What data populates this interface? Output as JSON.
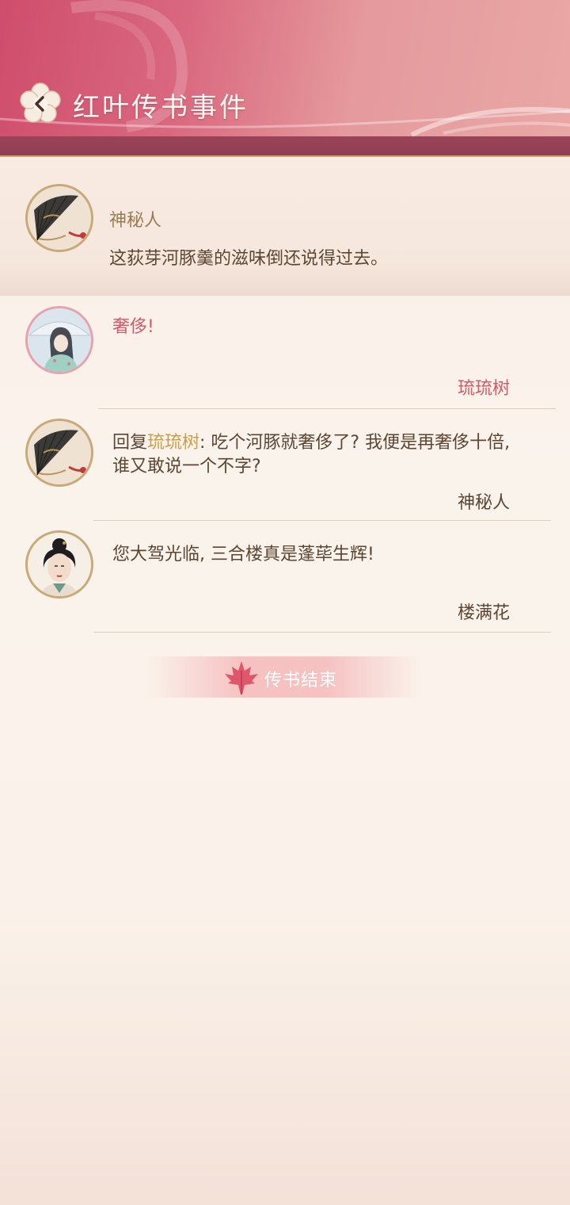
{
  "header": {
    "title": "红叶传书事件"
  },
  "post": {
    "author": "神秘人",
    "content": "这荻芽河豚羹的滋味倒还说得过去。",
    "avatar_icon": "folding-fan-icon"
  },
  "comments": [
    {
      "text": "奢侈!",
      "author": "琉琉树",
      "avatar_icon": "lady-umbrella-portrait"
    },
    {
      "reply_prefix": "回复",
      "reply_to": "琉琉树",
      "text": ": 吃个河豚就奢侈了? 我便是再奢侈十倍, 谁又敢说一个不字?",
      "author": "神秘人",
      "avatar_icon": "folding-fan-icon"
    },
    {
      "text": "您大驾光临, 三合楼真是蓬荜生辉!",
      "author": "楼满花",
      "avatar_icon": "lady-portrait"
    }
  ],
  "end_label": "传书结束",
  "colors": {
    "header": "#d9687f",
    "accent_pink": "#d45a6a",
    "gold": "#c9a04a",
    "text": "#5c4632"
  }
}
